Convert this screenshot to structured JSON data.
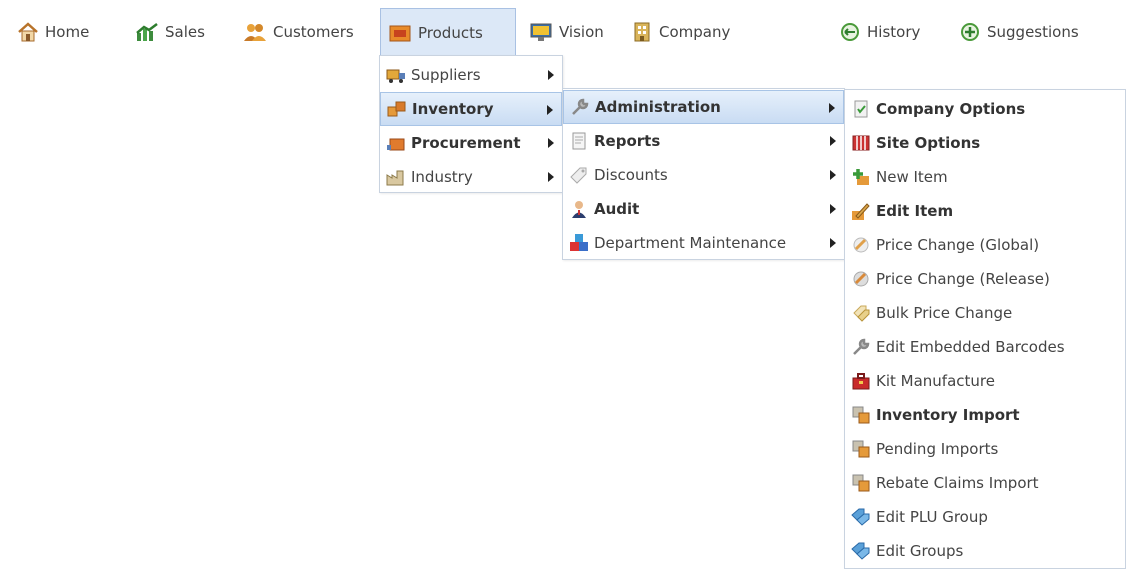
{
  "navbar": {
    "items": [
      {
        "label": "Home",
        "icon": "home-icon"
      },
      {
        "label": "Sales",
        "icon": "sales-chart-icon"
      },
      {
        "label": "Customers",
        "icon": "customers-icon"
      },
      {
        "label": "Products",
        "icon": "products-box-icon",
        "active": true
      },
      {
        "label": "Vision",
        "icon": "vision-monitor-icon"
      },
      {
        "label": "Company",
        "icon": "company-building-icon"
      },
      {
        "label": "History",
        "icon": "history-icon"
      },
      {
        "label": "Suggestions",
        "icon": "suggestions-icon"
      }
    ]
  },
  "products_menu": {
    "items": [
      {
        "label": "Suppliers",
        "icon": "truck-icon",
        "bold": false,
        "submenu": true
      },
      {
        "label": "Inventory",
        "icon": "inventory-boxes-icon",
        "bold": true,
        "submenu": true,
        "highlighted": true
      },
      {
        "label": "Procurement",
        "icon": "procurement-icon",
        "bold": true,
        "submenu": true
      },
      {
        "label": "Industry",
        "icon": "industry-factory-icon",
        "bold": false,
        "submenu": true
      }
    ]
  },
  "inventory_menu": {
    "items": [
      {
        "label": "Administration",
        "icon": "wrench-icon",
        "bold": true,
        "submenu": true,
        "highlighted": true
      },
      {
        "label": "Reports",
        "icon": "report-document-icon",
        "bold": true,
        "submenu": true
      },
      {
        "label": "Discounts",
        "icon": "tag-icon",
        "bold": false,
        "submenu": true
      },
      {
        "label": "Audit",
        "icon": "auditor-person-icon",
        "bold": true,
        "submenu": true
      },
      {
        "label": "Department Maintenance",
        "icon": "department-blocks-icon",
        "bold": false,
        "submenu": true
      }
    ]
  },
  "administration_menu": {
    "items": [
      {
        "label": "Company Options",
        "icon": "company-options-icon",
        "bold": true
      },
      {
        "label": "Site Options",
        "icon": "site-options-icon",
        "bold": true
      },
      {
        "label": "New Item",
        "icon": "new-item-plus-icon",
        "bold": false
      },
      {
        "label": "Edit Item",
        "icon": "edit-item-pencil-icon",
        "bold": true
      },
      {
        "label": "Price Change (Global)",
        "icon": "price-change-global-icon",
        "bold": false
      },
      {
        "label": "Price Change (Release)",
        "icon": "price-change-release-icon",
        "bold": false
      },
      {
        "label": "Bulk Price Change",
        "icon": "bulk-price-tag-icon",
        "bold": false
      },
      {
        "label": "Edit Embedded Barcodes",
        "icon": "wrench-icon",
        "bold": false
      },
      {
        "label": "Kit Manufacture",
        "icon": "toolbox-icon",
        "bold": false
      },
      {
        "label": "Inventory Import",
        "icon": "import-icon",
        "bold": true
      },
      {
        "label": "Pending Imports",
        "icon": "import-icon",
        "bold": false
      },
      {
        "label": "Rebate Claims Import",
        "icon": "import-icon",
        "bold": false
      },
      {
        "label": "Edit PLU Group",
        "icon": "group-tags-icon",
        "bold": false
      },
      {
        "label": "Edit Groups",
        "icon": "group-tags-icon",
        "bold": false
      }
    ]
  },
  "colors": {
    "highlight_bg": "#c9dcf3",
    "highlight_border": "#a8c4e6",
    "menu_border": "#c9d3e0",
    "text": "#444444"
  }
}
